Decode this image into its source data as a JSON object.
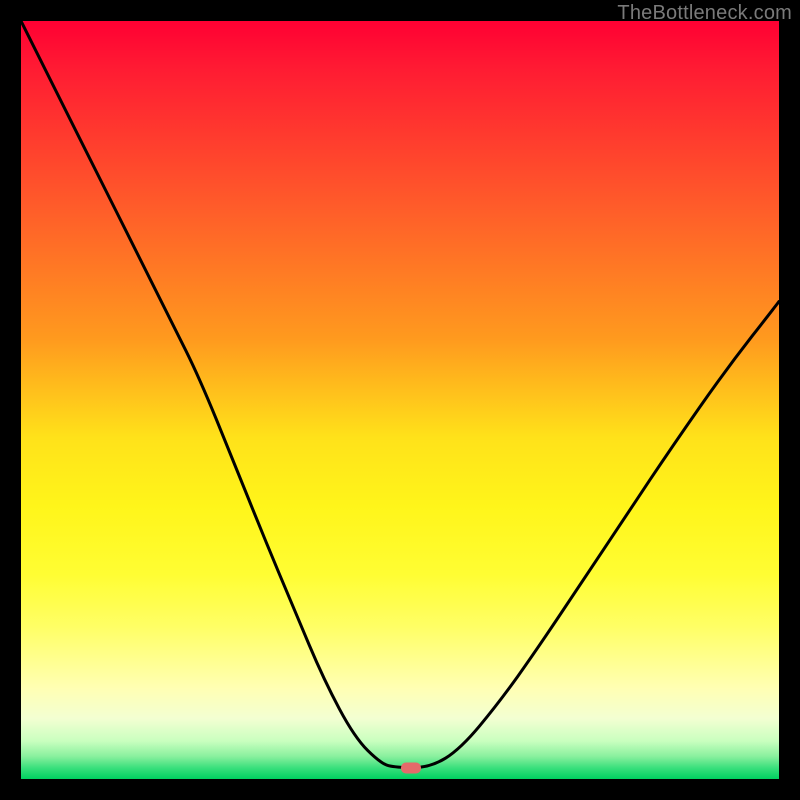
{
  "watermark": {
    "text": "TheBottleneck.com"
  },
  "marker": {
    "color": "#e56a6a",
    "x_frac": 0.515,
    "y_frac": 0.985
  },
  "chart_data": {
    "type": "line",
    "title": "",
    "xlabel": "",
    "ylabel": "",
    "xlim": [
      0,
      1
    ],
    "ylim": [
      0,
      1
    ],
    "grid": false,
    "legend": false,
    "gradient_stops": [
      {
        "pos": 0.0,
        "color": "#ff0033"
      },
      {
        "pos": 0.15,
        "color": "#ff3a2e"
      },
      {
        "pos": 0.33,
        "color": "#ff7a24"
      },
      {
        "pos": 0.55,
        "color": "#ffe21a"
      },
      {
        "pos": 0.73,
        "color": "#fffd33"
      },
      {
        "pos": 0.88,
        "color": "#ffffb3"
      },
      {
        "pos": 0.95,
        "color": "#c9ffbf"
      },
      {
        "pos": 1.0,
        "color": "#00d060"
      }
    ],
    "series": [
      {
        "name": "bottleneck-curve",
        "color": "#000000",
        "x": [
          0.0,
          0.05,
          0.1,
          0.15,
          0.2,
          0.235,
          0.28,
          0.32,
          0.36,
          0.4,
          0.44,
          0.475,
          0.495,
          0.54,
          0.58,
          0.63,
          0.68,
          0.74,
          0.8,
          0.86,
          0.93,
          1.0
        ],
        "y": [
          1.0,
          0.9,
          0.8,
          0.7,
          0.6,
          0.53,
          0.42,
          0.32,
          0.225,
          0.13,
          0.055,
          0.02,
          0.015,
          0.015,
          0.04,
          0.1,
          0.17,
          0.26,
          0.35,
          0.44,
          0.54,
          0.63
        ]
      }
    ],
    "marker": {
      "x": 0.515,
      "y": 0.015,
      "color": "#e56a6a"
    }
  }
}
